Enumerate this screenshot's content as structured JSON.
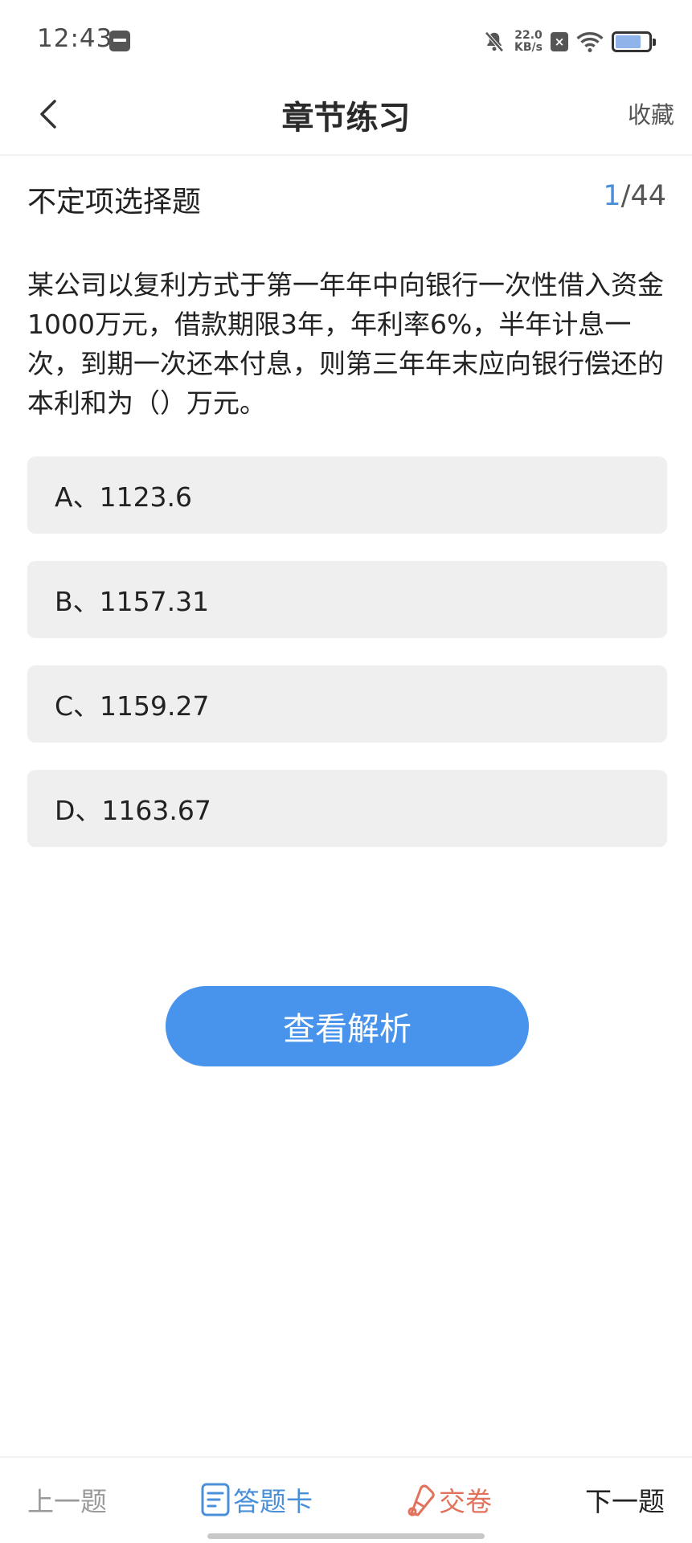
{
  "status_bar": {
    "time": "12:43",
    "net_speed_value": "22.0",
    "net_speed_unit": "KB/s",
    "icons": [
      "app-icon",
      "mute-icon",
      "close-icon",
      "wifi-icon",
      "battery-icon"
    ]
  },
  "header": {
    "title": "章节练习",
    "favorite_label": "收藏"
  },
  "question": {
    "type": "不定项选择题",
    "current": "1",
    "total": "/44",
    "text": "某公司以复利方式于第一年年中向银行一次性借入资金1000万元，借款期限3年，年利率6%，半年计息一次，到期一次还本付息，则第三年年末应向银行偿还的本利和为（）万元。",
    "options": [
      "A、1123.6",
      "B、1157.31",
      "C、1159.27",
      "D、1163.67"
    ]
  },
  "analysis_button": "查看解析",
  "bottom_bar": {
    "prev": "上一题",
    "answer_card": "答题卡",
    "submit": "交卷",
    "next": "下一题"
  },
  "colors": {
    "accent": "#4894ec",
    "submit": "#e2725b",
    "option_bg": "#efefef"
  }
}
